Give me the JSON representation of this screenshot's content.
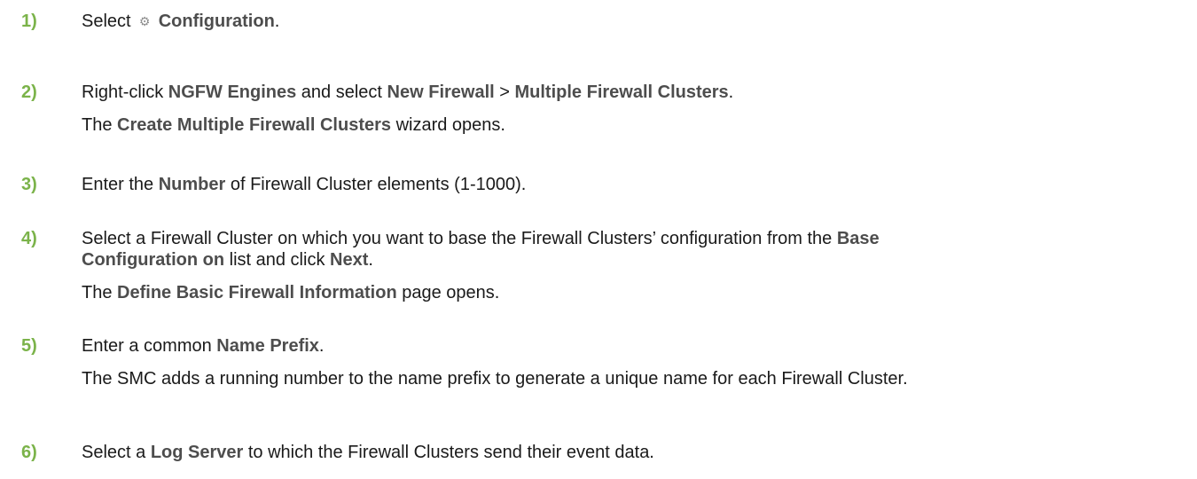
{
  "steps": [
    {
      "number": "1)",
      "lines": [
        {
          "segments": [
            {
              "text": "Select ",
              "bold": false
            },
            {
              "icon": "gear-icon"
            },
            {
              "text": " Configuration",
              "bold": true
            },
            {
              "text": ".",
              "bold": false
            }
          ]
        }
      ]
    },
    {
      "number": "2)",
      "lines": [
        {
          "segments": [
            {
              "text": "Right-click ",
              "bold": false
            },
            {
              "text": "NGFW Engines",
              "bold": true
            },
            {
              "text": " and select ",
              "bold": false
            },
            {
              "text": "New Firewall",
              "bold": true
            },
            {
              "text": " > ",
              "bold": false
            },
            {
              "text": "Multiple Firewall Clusters",
              "bold": true
            },
            {
              "text": ".",
              "bold": false
            }
          ]
        },
        {
          "segments": [
            {
              "text": "The ",
              "bold": false
            },
            {
              "text": "Create Multiple Firewall Clusters",
              "bold": true
            },
            {
              "text": " wizard opens.",
              "bold": false
            }
          ]
        }
      ]
    },
    {
      "number": "3)",
      "lines": [
        {
          "segments": [
            {
              "text": "Enter the ",
              "bold": false
            },
            {
              "text": "Number",
              "bold": true
            },
            {
              "text": " of Firewall Cluster elements (1-1000).",
              "bold": false
            }
          ]
        }
      ]
    },
    {
      "number": "4)",
      "lines": [
        {
          "segments": [
            {
              "text": "Select a Firewall Cluster on which you want to base the Firewall Clusters’ configuration from the ",
              "bold": false
            },
            {
              "text": "Base",
              "bold": true
            }
          ]
        },
        {
          "segments": [
            {
              "text": "Configuration on",
              "bold": true
            },
            {
              "text": " list and click ",
              "bold": false
            },
            {
              "text": "Next",
              "bold": true
            },
            {
              "text": ".",
              "bold": false
            }
          ]
        },
        {
          "segments": [
            {
              "text": "The ",
              "bold": false
            },
            {
              "text": "Define Basic Firewall Information",
              "bold": true
            },
            {
              "text": " page opens.",
              "bold": false
            }
          ]
        }
      ]
    },
    {
      "number": "5)",
      "lines": [
        {
          "segments": [
            {
              "text": "Enter a common ",
              "bold": false
            },
            {
              "text": "Name Prefix",
              "bold": true
            },
            {
              "text": ".",
              "bold": false
            }
          ]
        },
        {
          "segments": [
            {
              "text": "The SMC adds a running number to the name prefix to generate a unique name for each Firewall Cluster.",
              "bold": false
            }
          ]
        }
      ]
    },
    {
      "number": "6)",
      "lines": [
        {
          "segments": [
            {
              "text": "Select a ",
              "bold": false
            },
            {
              "text": "Log Server",
              "bold": true
            },
            {
              "text": " to which the Firewall Clusters send their event data.",
              "bold": false
            }
          ]
        }
      ]
    }
  ],
  "colors": {
    "step_number": "#7bb34a",
    "ui_term": "#4d4d4d",
    "body_text": "#1a1a1a"
  }
}
